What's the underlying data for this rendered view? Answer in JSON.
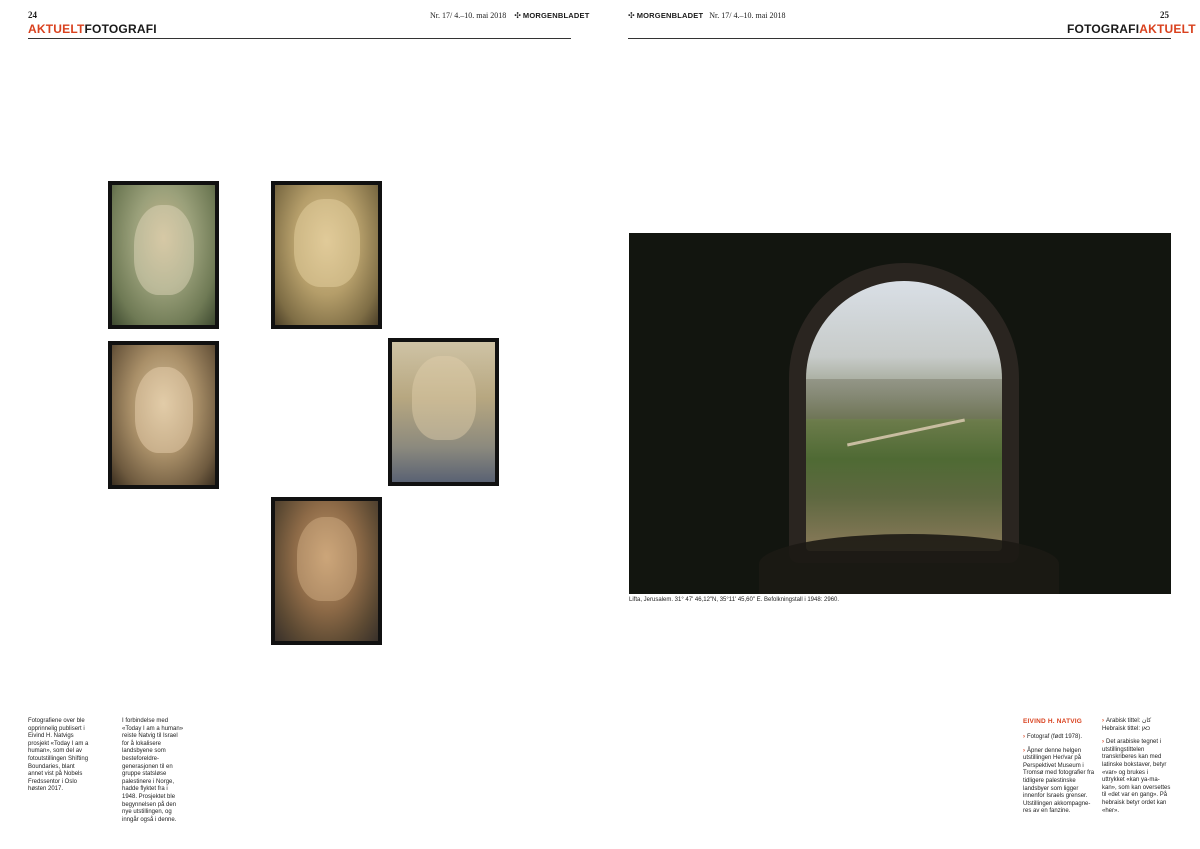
{
  "left_page": {
    "page_number": "24",
    "issue_line": "Nr. 17/ 4.–10. mai 2018",
    "masthead": "MORGENBLADET",
    "masthead_logo": "morgenbladet-emblem",
    "section_red": "AKTUELT",
    "section_black": "FOTOGRAFI",
    "portraits": [
      {
        "name": "portrait-1",
        "depicts": "overlaid portrait, eyes closed, greenery"
      },
      {
        "name": "portrait-2",
        "depicts": "overlaid portrait, man with dried grass beard"
      },
      {
        "name": "portrait-3",
        "depicts": "overlaid portrait, woman in headscarf"
      },
      {
        "name": "portrait-4",
        "depicts": "overlaid portrait, man with moustache"
      },
      {
        "name": "portrait-5",
        "depicts": "overlaid portrait, young man"
      }
    ],
    "column_1": "Fotografiene over ble opprinnelig publisert i Eivind H. Natvigs prosjekt «Today I am a human», som del av fotoutstillingen Shifting Boundaries, blant annet vist på Nobels Fredssentor i Oslo høsten 2017.",
    "column_2": "I forbindelse med «Today I am a human» reiste Natvig til Israel for å lokalisere landsbyene som besteforeldre­generasjonen til en gruppe statsløse palestinere i Norge, hadde flyktet fra i 1948. Prosjektet ble begynnelsen på den nye utstillingen, og inngår også i denne."
  },
  "right_page": {
    "page_number": "25",
    "issue_line": "Nr. 17/ 4.–10. mai 2018",
    "masthead": "MORGENBLADET",
    "masthead_logo": "morgenbladet-emblem",
    "section_black": "FOTOGRAFI",
    "section_red": "AKTUELT",
    "photo_caption": "Lifta, Jerusalem. 31° 47' 46,12\"N, 35°11' 45,60\" E. Befolkningstall i 1948: 2960.",
    "byline": "EIVIND H. NATVIG",
    "fact_1": "Fotograf (født 1978).",
    "fact_2": "Åpner denne helgen utstillingen Her/var på Perspektivet Museum i Tromsø med fotografier fra tidligere palestinske landsbyer som ligger innenfor Israels grenser. Utstillingen akkompagne­res av en fanzine.",
    "fact_3_ar": "Arabisk tittel: كان",
    "fact_3_he": "Hebraisk tittel: כאן",
    "fact_4": "Det arabiske tegnet i utstillingstittelen transkriberes kan med latinske bokstaver, betyr «var» og brukes i uttrykket «kan ya-ma-kan», som kan over­settes til «det var en gang». På hebraisk betyr ordet kan «her»."
  },
  "colors": {
    "accent": "#d9411e",
    "text": "#1a1a1a",
    "rule": "#333333"
  }
}
